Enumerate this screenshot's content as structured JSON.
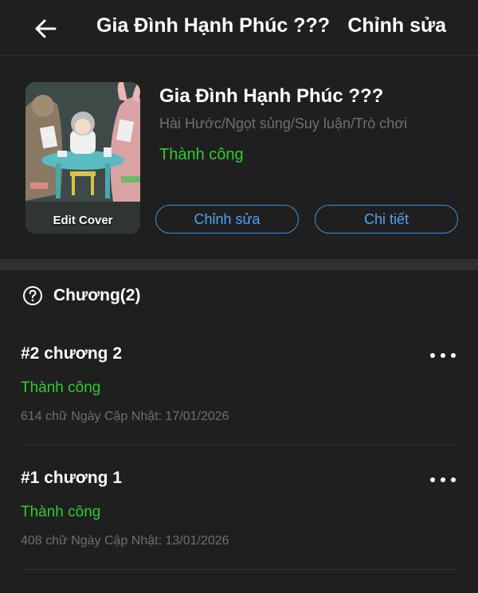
{
  "header": {
    "back_icon": "arrow-left-icon",
    "title": "Gia Đình Hạnh Phúc ???",
    "edit_label": "Chỉnh sửa"
  },
  "book": {
    "title": "Gia Đình Hạnh Phúc ???",
    "genres": "Hài Hước/Ngọt sủng/Suy luận/Trò chơi",
    "status": "Thành công",
    "edit_cover_label": "Edit Cover",
    "edit_button": "Chỉnh sửa",
    "detail_button": "Chi tiết"
  },
  "chapters_section": {
    "icon": "question-circle-icon",
    "label": "Chương(2)"
  },
  "chapters": [
    {
      "title": "#2 chương 2",
      "status": "Thành công",
      "meta": "614 chữ Ngày Cập Nhật: 17/01/2026"
    },
    {
      "title": "#1 chương 1",
      "status": "Thành công",
      "meta": "408 chữ Ngày Cập Nhật: 13/01/2026"
    }
  ],
  "colors": {
    "background": "#1f1f1f",
    "success": "#2fcb2f",
    "accent": "#3a8fde",
    "muted": "#707070"
  }
}
